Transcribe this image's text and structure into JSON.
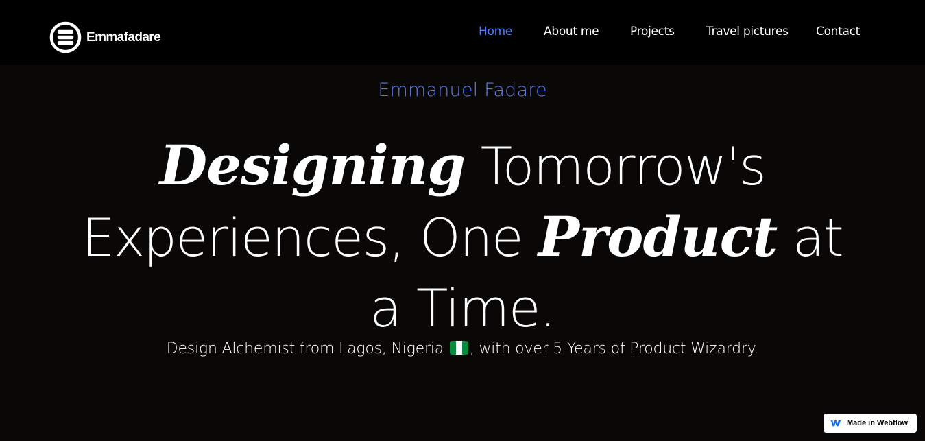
{
  "brand": {
    "name": "Emmafadare",
    "logo_icon": "stacked-bars-circle-icon"
  },
  "nav": {
    "items": [
      {
        "label": "Home",
        "active": true
      },
      {
        "label": "About me",
        "active": false
      },
      {
        "label": "Projects",
        "active": false
      },
      {
        "label": "Travel pictures",
        "active": false
      },
      {
        "label": "Contact",
        "active": false
      }
    ]
  },
  "hero": {
    "eyebrow": "Emmanuel Fadare",
    "headline": {
      "line1_emphasis": "Designing",
      "line1_rest": "Tomorrow's",
      "line2_start": "Experiences, One",
      "line2_emphasis": "Product",
      "line2_end": "at",
      "line3": "a Time."
    },
    "subtext_before": "Design Alchemist from Lagos, Nigeria",
    "subtext_after": ", with over 5 Years of Product Wizardry.",
    "flag_icon": "nigeria-flag-icon"
  },
  "badge": {
    "label": "Made in Webflow",
    "icon": "webflow-icon"
  },
  "colors": {
    "accent": "#4f7df2",
    "eyebrow": "#5a78e6",
    "nav_background": "#000000",
    "hero_background": "#0a0707",
    "text": "#ffffff"
  }
}
